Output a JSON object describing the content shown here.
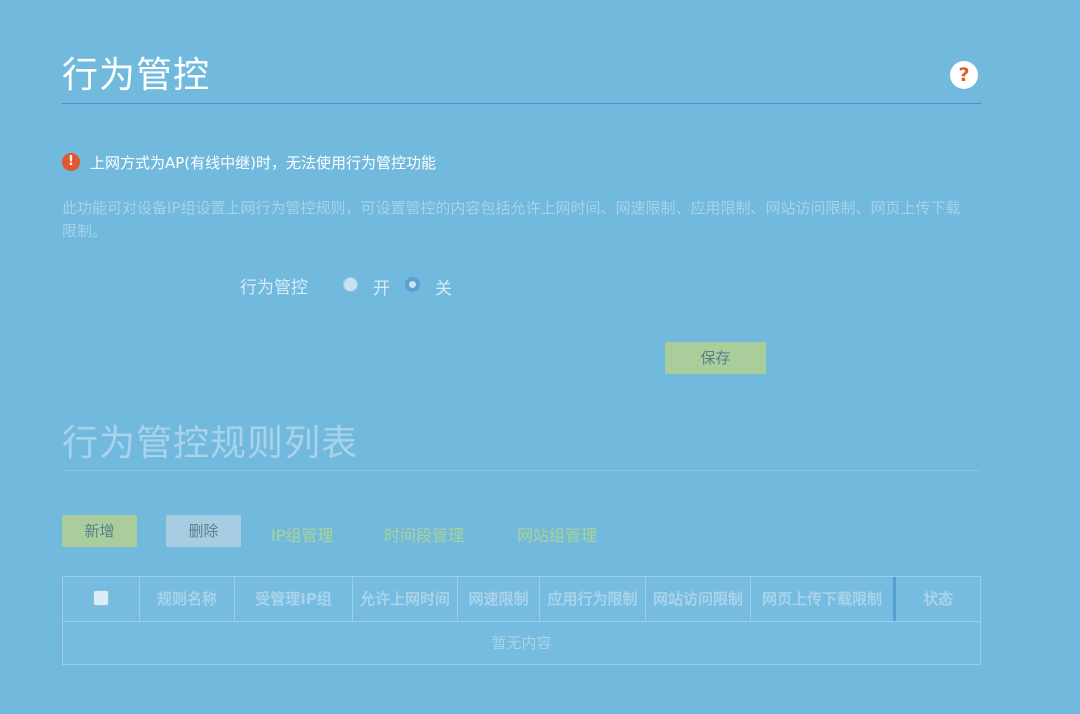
{
  "page": {
    "title": "行为管控",
    "help_icon": "question-icon",
    "help_glyph": "?",
    "warning_icon_glyph": "!",
    "warning": "上网方式为AP(有线中继)时，无法使用行为管控功能",
    "description": "此功能可对设备IP组设置上网行为管控规则，可设置管控的内容包括允许上网时间、网速限制、应用限制、网站访问限制、网页上传下载限制。"
  },
  "control": {
    "label": "行为管控",
    "on_label": "开",
    "off_label": "关",
    "selected": "关"
  },
  "save_label": "保存",
  "rules": {
    "title": "行为管控规则列表",
    "add_label": "新增",
    "delete_label": "删除",
    "links": [
      "IP组管理",
      "时间段管理",
      "网站组管理"
    ],
    "columns": [
      "规则名称",
      "受管理IP组",
      "允许上网时间",
      "网速限制",
      "应用行为限制",
      "网站访问限制",
      "网页上传下载限制",
      "状态"
    ],
    "empty_text": "暂无内容"
  },
  "colors": {
    "background": "#72b9de",
    "accent_green": "#a9ce9c",
    "warning_red": "#e2582e"
  }
}
